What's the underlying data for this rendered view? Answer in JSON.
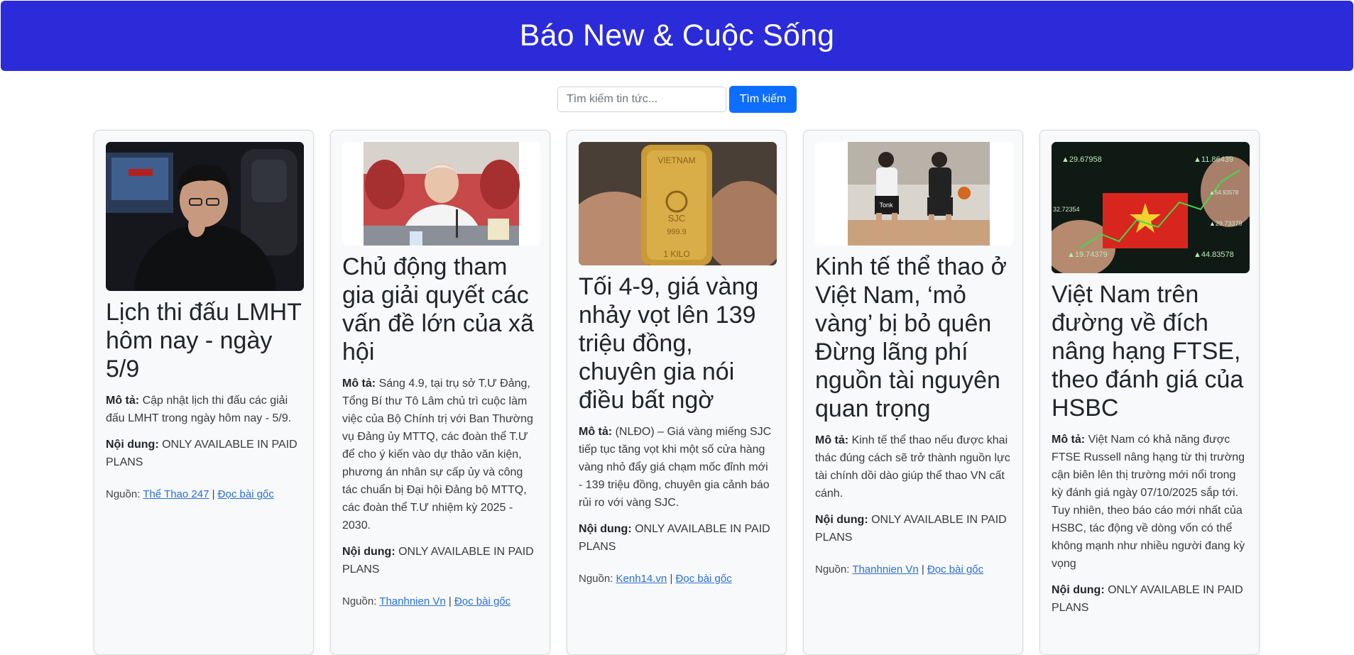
{
  "site_title": "Báo New & Cuộc Sống",
  "search": {
    "placeholder": "Tìm kiếm tin tức...",
    "button": "Tìm kiếm"
  },
  "labels": {
    "description": "Mô tả:",
    "content": "Nội dung:",
    "source": "Nguồn:",
    "separator": "|"
  },
  "articles": [
    {
      "title": "Lịch thi đấu LMHT hôm nay - ngày 5/9",
      "description": "Cập nhật lịch thi đấu các giải đấu LMHT trong ngày hôm nay - 5/9.",
      "content": "ONLY AVAILABLE IN PAID PLANS",
      "source": "Thể Thao 247",
      "read_more": "Đọc bài gốc"
    },
    {
      "title": "Chủ động tham gia giải quyết các vấn đề lớn của xã hội",
      "description": "Sáng 4.9, tại trụ sở T.Ư Đảng, Tổng Bí thư Tô Lâm chủ trì cuộc làm việc của Bộ Chính trị với Ban Thường vụ Đảng ủy MTTQ, các đoàn thể T.Ư để cho ý kiến vào dự thảo văn kiện, phương án nhân sự cấp ủy và công tác chuẩn bị Đại hội Đảng bộ MTTQ, các đoàn thể T.Ư nhiệm kỳ 2025 - 2030.",
      "content": "ONLY AVAILABLE IN PAID PLANS",
      "source": "Thanhnien Vn",
      "read_more": "Đọc bài gốc"
    },
    {
      "title": "Tối 4-9, giá vàng nhảy vọt lên 139 triệu đồng, chuyên gia nói điều bất ngờ",
      "description": "(NLĐO) – Giá vàng miếng SJC tiếp tục tăng vọt khi một số cửa hàng vàng nhỏ đẩy giá chạm mốc đỉnh mới - 139 triệu đồng, chuyên gia cảnh báo rủi ro với vàng SJC.",
      "content": "ONLY AVAILABLE IN PAID PLANS",
      "source": "Kenh14.vn",
      "read_more": "Đọc bài gốc"
    },
    {
      "title": "Kinh tế thể thao ở Việt Nam, ‘mỏ vàng’ bị bỏ quên Đừng lãng phí nguồn tài nguyên quan trọng",
      "description": "Kinh tế thể thao nếu được khai thác đúng cách sẽ trở thành nguồn lực tài chính dồi dào giúp thể thao VN cất cánh.",
      "content": "ONLY AVAILABLE IN PAID PLANS",
      "source": "Thanhnien Vn",
      "read_more": "Đọc bài gốc"
    },
    {
      "title": "Việt Nam trên đường về đích nâng hạng FTSE, theo đánh giá của HSBC",
      "description": "Việt Nam có khả năng được FTSE Russell nâng hạng từ thị trường cận biên lên thị trường mới nổi trong kỳ đánh giá ngày 07/10/2025 sắp tới. Tuy nhiên, theo báo cáo mới nhất của HSBC, tác động về dòng vốn có thể không mạnh như nhiều người đang kỳ vọng",
      "content": "ONLY AVAILABLE IN PAID PLANS",
      "source": null,
      "read_more": null
    }
  ],
  "image_text": {
    "gold_bar_top": "VIETNAM",
    "gold_bar_mark": "SJC",
    "gold_bar_purity": "999.9",
    "gold_bar_weight": "1 KILO",
    "jersey": "Tonk",
    "ticker_1": "▲29.67958",
    "ticker_2": "▲11.86439",
    "ticker_3": "32.72354",
    "ticker_4": "▲54.93578",
    "ticker_5": "▲29.73379",
    "ticker_6": "▲19.74379",
    "ticker_7": "▲44.83578"
  }
}
